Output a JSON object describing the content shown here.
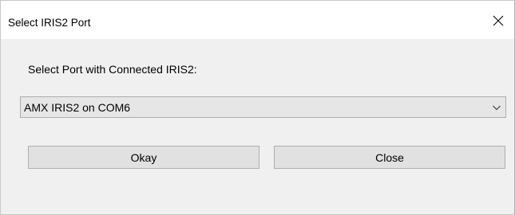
{
  "window": {
    "title": "Select IRIS2 Port",
    "close_icon": "close-icon"
  },
  "dialog": {
    "prompt": "Select Port with Connected IRIS2:",
    "port_select": {
      "selected_value": "AMX IRIS2 on COM6",
      "icon": "chevron-down-icon"
    },
    "okay_label": "Okay",
    "close_label": "Close"
  },
  "colors": {
    "titlebar_bg": "#ffffff",
    "dialog_bg": "#f0f0f0",
    "button_bg": "#e1e1e1",
    "combo_bg": "#e6e6e6",
    "border": "#adadad"
  }
}
